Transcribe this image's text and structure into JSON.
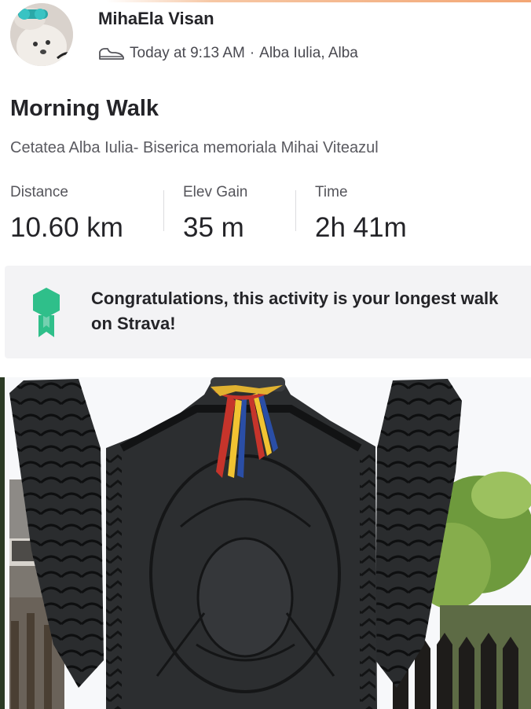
{
  "header": {
    "athlete_name": "MihaEla Visan",
    "activity_icon": "shoe-icon",
    "timestamp": "Today at 9:13 AM",
    "separator": "·",
    "location": "Alba Iulia, Alba"
  },
  "activity": {
    "title": "Morning Walk",
    "description": "Cetatea Alba Iulia- Biserica memoriala Mihai Viteazul"
  },
  "stats": [
    {
      "label": "Distance",
      "value": "10.60 km"
    },
    {
      "label": "Elev Gain",
      "value": "35 m"
    },
    {
      "label": "Time",
      "value": "2h 41m"
    }
  ],
  "achievement": {
    "icon": "achievement-badge-icon",
    "text": "Congratulations, this activity is your longest walk on Strava!",
    "color": "#2fbf8a"
  },
  "colors": {
    "accent": "#fc4c02",
    "banner_background": "#f3f3f5",
    "text_primary": "#242428",
    "text_secondary": "#5a5a60"
  }
}
